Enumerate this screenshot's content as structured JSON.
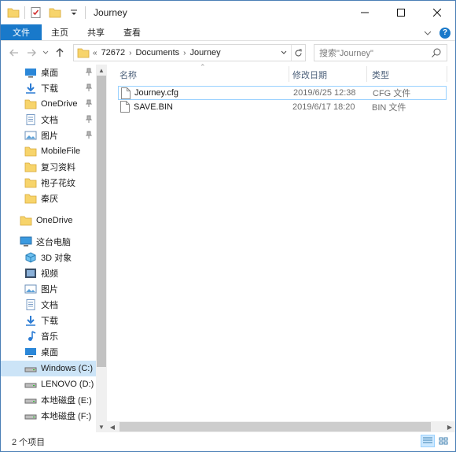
{
  "window": {
    "title": "Journey"
  },
  "ribbon": {
    "tabs": [
      "文件",
      "主页",
      "共享",
      "查看"
    ]
  },
  "address": {
    "overflow": "«",
    "crumbs": [
      "72672",
      "Documents",
      "Journey"
    ]
  },
  "search": {
    "placeholder": "搜索\"Journey\""
  },
  "nav": {
    "items": [
      {
        "label": "桌面",
        "icon": "desktop-icon",
        "pinned": true
      },
      {
        "label": "下载",
        "icon": "download-icon",
        "pinned": true
      },
      {
        "label": "OneDrive",
        "icon": "folder-icon",
        "pinned": true
      },
      {
        "label": "文档",
        "icon": "document-icon",
        "pinned": true
      },
      {
        "label": "图片",
        "icon": "picture-icon",
        "pinned": true
      },
      {
        "label": "MobileFile",
        "icon": "folder-icon"
      },
      {
        "label": "复习资料",
        "icon": "folder-icon"
      },
      {
        "label": "袍子花纹",
        "icon": "folder-icon"
      },
      {
        "label": "秦厌",
        "icon": "folder-icon"
      },
      {
        "label": "OneDrive",
        "icon": "folder-icon"
      },
      {
        "label": "这台电脑",
        "icon": "computer-icon"
      },
      {
        "label": "3D 对象",
        "icon": "cube-icon"
      },
      {
        "label": "视频",
        "icon": "video-icon"
      },
      {
        "label": "图片",
        "icon": "picture-icon"
      },
      {
        "label": "文档",
        "icon": "document-icon"
      },
      {
        "label": "下载",
        "icon": "download-icon"
      },
      {
        "label": "音乐",
        "icon": "music-icon"
      },
      {
        "label": "桌面",
        "icon": "desktop-icon"
      },
      {
        "label": "Windows (C:)",
        "icon": "drive-icon",
        "selected": true
      },
      {
        "label": "LENOVO (D:)",
        "icon": "drive-icon"
      },
      {
        "label": "本地磁盘 (E:)",
        "icon": "drive-icon"
      },
      {
        "label": "本地磁盘 (F:)",
        "icon": "drive-icon"
      }
    ]
  },
  "columns": {
    "name": "名称",
    "date": "修改日期",
    "type": "类型"
  },
  "files": [
    {
      "name": "Journey.cfg",
      "date": "2019/6/25 12:38",
      "type": "CFG 文件"
    },
    {
      "name": "SAVE.BIN",
      "date": "2019/6/17 18:20",
      "type": "BIN 文件"
    }
  ],
  "status": {
    "count": "2 个项目"
  },
  "colors": {
    "accent": "#1979ca",
    "selection": "#cce4f7",
    "folder": "#f7d46b"
  }
}
